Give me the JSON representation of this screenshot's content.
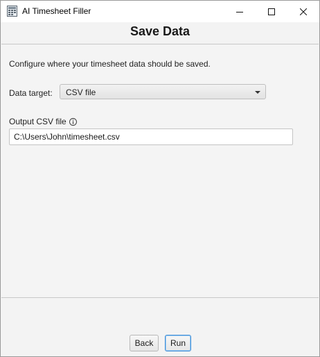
{
  "window": {
    "title": "AI Timesheet Filler",
    "controls": {
      "minimize": "minimize-icon",
      "maximize": "maximize-icon",
      "close": "close-icon"
    }
  },
  "page": {
    "title": "Save Data",
    "description": "Configure where your timesheet data should be saved."
  },
  "form": {
    "data_target_label": "Data target:",
    "data_target_value": "CSV file",
    "output_label": "Output CSV file",
    "output_value": "C:\\Users\\John\\timesheet.csv"
  },
  "buttons": {
    "back": "Back",
    "run": "Run"
  },
  "colors": {
    "focus_border": "#3f8fd8",
    "background": "#f3f3f3"
  }
}
